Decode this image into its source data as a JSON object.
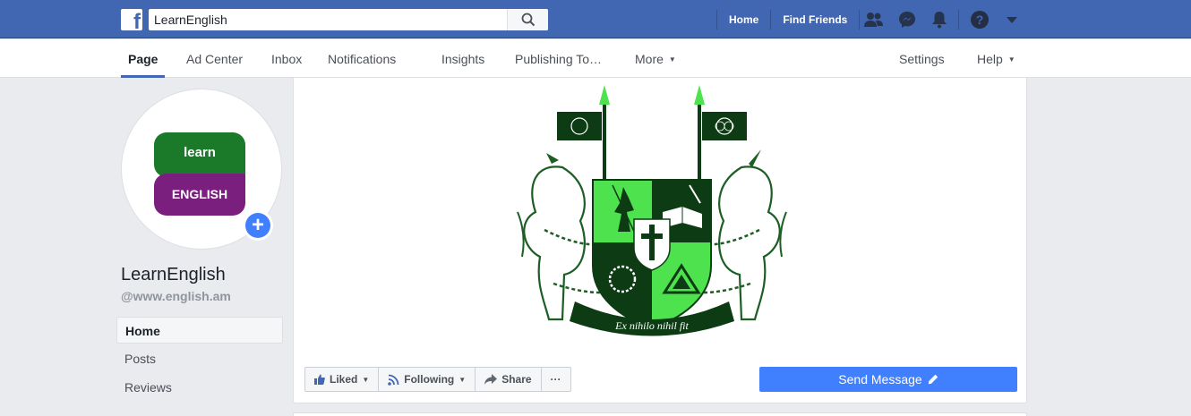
{
  "topbar": {
    "search_value": "LearnEnglish",
    "home_label": "Home",
    "find_friends_label": "Find Friends",
    "brand_color": "#4267b2"
  },
  "page_tabs": [
    {
      "label": "Page"
    },
    {
      "label": "Ad Center"
    },
    {
      "label": "Inbox"
    },
    {
      "label": "Notifications"
    },
    {
      "label": "Insights"
    },
    {
      "label": "Publishing To…"
    },
    {
      "label": "More"
    },
    {
      "label": "Settings"
    },
    {
      "label": "Help"
    }
  ],
  "profile": {
    "logo_top_text": "learn",
    "logo_bottom_text": "ENGLISH",
    "name": "LearnEnglish",
    "handle": "@www.english.am"
  },
  "sidebar": {
    "items": [
      {
        "label": "Home"
      },
      {
        "label": "Posts"
      },
      {
        "label": "Reviews"
      }
    ]
  },
  "cover": {
    "motto": "Ex nihilo nihil fit"
  },
  "actions": {
    "liked_label": "Liked",
    "following_label": "Following",
    "share_label": "Share",
    "more_label": "···",
    "send_message_label": "Send Message"
  },
  "icons": [
    "facebook-logo-icon",
    "search-icon",
    "friends-icon",
    "messenger-icon",
    "bell-icon",
    "help-icon",
    "caret-down-icon",
    "thumbs-up-icon",
    "rss-icon",
    "share-arrow-icon",
    "pencil-icon",
    "plus-icon"
  ]
}
